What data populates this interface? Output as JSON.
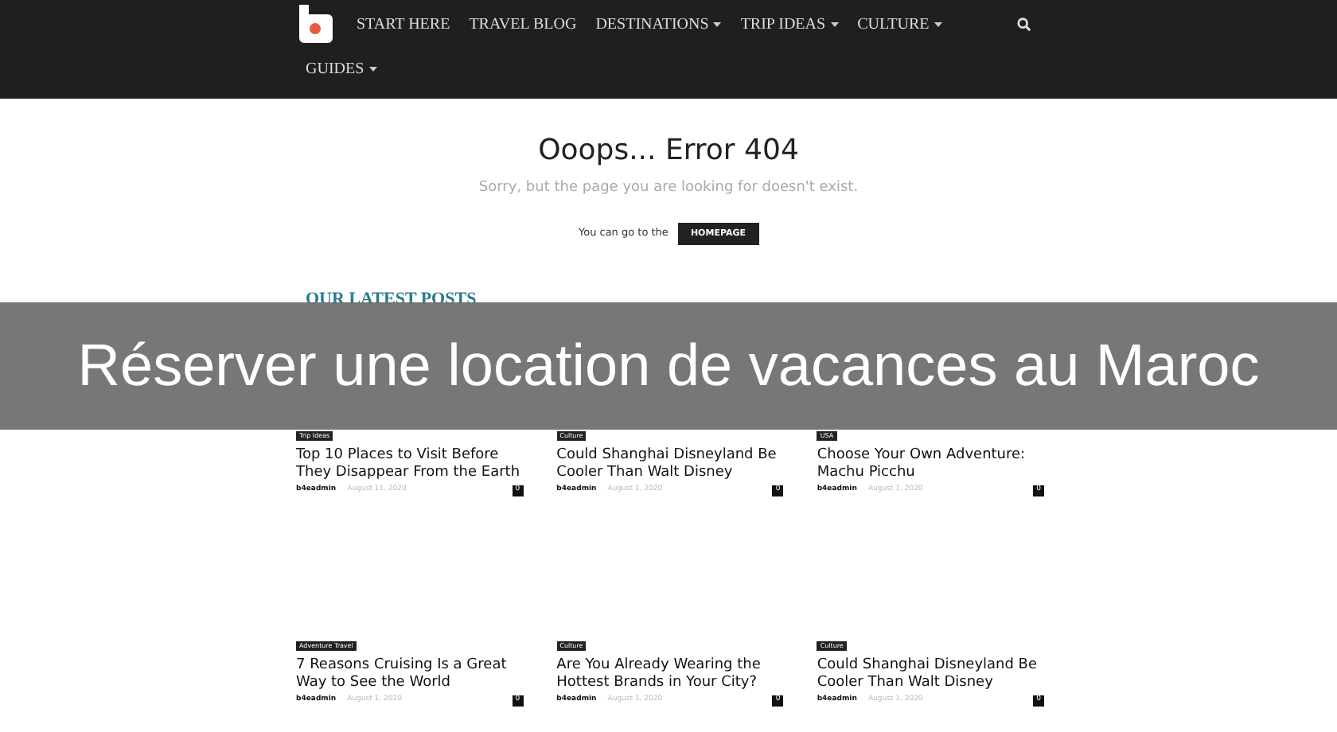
{
  "nav": {
    "items": [
      {
        "label": "START HERE",
        "dropdown": false
      },
      {
        "label": "TRAVEL BLOG",
        "dropdown": false
      },
      {
        "label": "DESTINATIONS",
        "dropdown": true
      },
      {
        "label": "TRIP IDEAS",
        "dropdown": true
      },
      {
        "label": "CULTURE",
        "dropdown": true
      },
      {
        "label": "GUIDES",
        "dropdown": true
      }
    ]
  },
  "error": {
    "title": "Ooops... Error 404",
    "message": "Sorry, but the page you are looking for doesn't exist.",
    "prompt": "You can go to the",
    "button": "HOMEPAGE"
  },
  "latest_posts": {
    "heading": "OUR LATEST POSTS",
    "posts": [
      {
        "category": "Trip Ideas",
        "title": "Top 10 Places to Visit Before They Disappear From the Earth",
        "author": "b4eadmin",
        "date": "August 11, 2020",
        "comments": "0"
      },
      {
        "category": "Culture",
        "title": "Could Shanghai Disneyland Be Cooler Than Walt Disney",
        "author": "b4eadmin",
        "date": "August 1, 2020",
        "comments": "0"
      },
      {
        "category": "USA",
        "title": "Choose Your Own Adventure: Machu Picchu",
        "author": "b4eadmin",
        "date": "August 1, 2020",
        "comments": "0"
      },
      {
        "category": "Adventure Travel",
        "title": "7 Reasons Cruising Is a Great Way to See the World",
        "author": "b4eadmin",
        "date": "August 1, 2020",
        "comments": "0"
      },
      {
        "category": "Culture",
        "title": "Are You Already Wearing the Hottest Brands in Your City?",
        "author": "b4eadmin",
        "date": "August 1, 2020",
        "comments": "0"
      },
      {
        "category": "Culture",
        "title": "Could Shanghai Disneyland Be Cooler Than Walt Disney",
        "author": "b4eadmin",
        "date": "August 1, 2020",
        "comments": "0"
      }
    ]
  },
  "banner": {
    "text": "Réserver une location de vacances au Maroc"
  }
}
